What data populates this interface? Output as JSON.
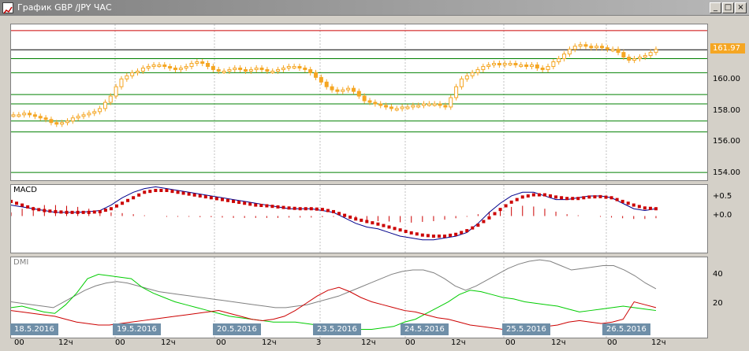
{
  "window": {
    "title": "График GBP /JPY ЧАС",
    "minimize_label": "_",
    "maximize_label": "□",
    "close_label": "×"
  },
  "price": {
    "current_label": "161.97",
    "current_value": 161.97,
    "ymin": 153.6,
    "ymax": 163.6,
    "ticks": [
      {
        "value": 160,
        "label": "160.00"
      },
      {
        "value": 158,
        "label": "158.00"
      },
      {
        "value": 156,
        "label": "156.00"
      },
      {
        "value": 154,
        "label": "154.00"
      }
    ],
    "red_levels": [
      163.2
    ],
    "black_levels": [
      161.97
    ],
    "green_levels": [
      161.4,
      160.5,
      159.1,
      158.5,
      157.4,
      156.7,
      154.1
    ],
    "closes": [
      157.8,
      157.8,
      157.9,
      157.8,
      157.7,
      157.6,
      157.5,
      157.3,
      157.2,
      157.3,
      157.4,
      157.6,
      157.7,
      157.8,
      157.9,
      158.0,
      158.2,
      158.6,
      159.0,
      159.6,
      160.1,
      160.3,
      160.5,
      160.6,
      160.8,
      160.9,
      161.0,
      161.0,
      160.9,
      160.8,
      160.7,
      160.8,
      160.9,
      161.1,
      161.2,
      161.1,
      160.9,
      160.7,
      160.6,
      160.6,
      160.7,
      160.8,
      160.7,
      160.6,
      160.7,
      160.8,
      160.7,
      160.6,
      160.6,
      160.7,
      160.8,
      160.9,
      160.9,
      160.8,
      160.7,
      160.5,
      160.2,
      159.9,
      159.6,
      159.4,
      159.3,
      159.4,
      159.5,
      159.3,
      159.0,
      158.7,
      158.6,
      158.5,
      158.4,
      158.3,
      158.2,
      158.2,
      158.3,
      158.3,
      158.4,
      158.4,
      158.5,
      158.5,
      158.5,
      158.4,
      158.3,
      158.9,
      159.6,
      160.1,
      160.3,
      160.5,
      160.7,
      160.9,
      161.0,
      161.1,
      161.0,
      161.1,
      161.1,
      161.0,
      161.0,
      160.9,
      161.0,
      160.8,
      160.7,
      160.9,
      161.2,
      161.4,
      161.7,
      162.0,
      162.2,
      162.3,
      162.2,
      162.1,
      162.2,
      162.1,
      162.0,
      162.0,
      161.8,
      161.5,
      161.3,
      161.4,
      161.5,
      161.6,
      161.8,
      162.0
    ]
  },
  "macd": {
    "title": "MACD",
    "ymin": -1.0,
    "ymax": 0.85,
    "ticks": [
      {
        "value": 0.5,
        "label": "+0.5"
      },
      {
        "value": 0.0,
        "label": "+0.0"
      }
    ],
    "macd_line": [
      0.3,
      0.25,
      0.2,
      0.15,
      0.1,
      0.1,
      0.1,
      0.12,
      0.15,
      0.3,
      0.5,
      0.65,
      0.75,
      0.8,
      0.75,
      0.7,
      0.65,
      0.6,
      0.55,
      0.5,
      0.45,
      0.4,
      0.35,
      0.3,
      0.25,
      0.2,
      0.2,
      0.2,
      0.15,
      0.1,
      -0.05,
      -0.2,
      -0.3,
      -0.35,
      -0.45,
      -0.55,
      -0.6,
      -0.65,
      -0.65,
      -0.6,
      -0.55,
      -0.45,
      -0.2,
      0.1,
      0.35,
      0.55,
      0.65,
      0.65,
      0.55,
      0.45,
      0.45,
      0.5,
      0.55,
      0.55,
      0.5,
      0.35,
      0.2,
      0.15,
      0.2
    ],
    "signal_line": [
      0.4,
      0.3,
      0.2,
      0.15,
      0.12,
      0.1,
      0.1,
      0.1,
      0.12,
      0.2,
      0.35,
      0.5,
      0.65,
      0.7,
      0.7,
      0.65,
      0.6,
      0.55,
      0.5,
      0.45,
      0.4,
      0.35,
      0.3,
      0.28,
      0.25,
      0.22,
      0.2,
      0.2,
      0.18,
      0.12,
      0.02,
      -0.08,
      -0.15,
      -0.22,
      -0.3,
      -0.38,
      -0.46,
      -0.52,
      -0.55,
      -0.55,
      -0.5,
      -0.4,
      -0.25,
      -0.05,
      0.18,
      0.38,
      0.52,
      0.58,
      0.58,
      0.52,
      0.48,
      0.48,
      0.52,
      0.53,
      0.5,
      0.4,
      0.3,
      0.22,
      0.2
    ],
    "histogram": [
      0.1,
      0.2,
      0.25,
      0.3,
      0.3,
      0.28,
      0.25,
      0.2,
      0.15,
      0.1,
      0.08,
      0.05,
      0.02,
      0.0,
      -0.02,
      -0.02,
      -0.02,
      -0.03,
      -0.03,
      -0.04,
      -0.05,
      -0.05,
      -0.05,
      -0.05,
      -0.05,
      -0.04,
      -0.04,
      -0.04,
      -0.03,
      -0.02,
      -0.04,
      -0.08,
      -0.12,
      -0.14,
      -0.15,
      -0.17,
      -0.18,
      -0.16,
      -0.14,
      -0.1,
      -0.06,
      -0.02,
      0.05,
      0.12,
      0.2,
      0.25,
      0.28,
      0.26,
      0.2,
      0.12,
      0.05,
      0.02,
      0.0,
      -0.02,
      -0.04,
      -0.06,
      -0.08,
      -0.08,
      -0.06
    ]
  },
  "dmi": {
    "title": "DMI",
    "ymin": 0,
    "ymax": 50,
    "ticks": [
      {
        "value": 40,
        "label": "40"
      },
      {
        "value": 20,
        "label": "20"
      }
    ],
    "adx": [
      22,
      21,
      20,
      19,
      18,
      22,
      26,
      30,
      33,
      35,
      36,
      35,
      33,
      31,
      29,
      28,
      27,
      26,
      25,
      24,
      23,
      22,
      21,
      20,
      19,
      18,
      18,
      19,
      20,
      22,
      24,
      26,
      29,
      32,
      35,
      38,
      41,
      43,
      44,
      44,
      42,
      38,
      33,
      30,
      33,
      37,
      41,
      45,
      48,
      50,
      51,
      50,
      47,
      44,
      45,
      46,
      47,
      47,
      44,
      40,
      35,
      31
    ],
    "plus_di": [
      18,
      19,
      17,
      15,
      14,
      20,
      28,
      38,
      41,
      40,
      39,
      38,
      32,
      28,
      25,
      22,
      20,
      18,
      16,
      14,
      12,
      11,
      10,
      9,
      8,
      8,
      8,
      7,
      6,
      5,
      4,
      4,
      3,
      3,
      4,
      5,
      8,
      10,
      14,
      18,
      22,
      27,
      30,
      29,
      27,
      25,
      24,
      22,
      21,
      20,
      19,
      17,
      15,
      16,
      17,
      18,
      19,
      18,
      17,
      16
    ],
    "minus_di": [
      16,
      15,
      14,
      13,
      12,
      10,
      8,
      7,
      6,
      6,
      7,
      8,
      9,
      10,
      11,
      12,
      13,
      14,
      15,
      16,
      14,
      12,
      10,
      9,
      10,
      12,
      16,
      21,
      26,
      30,
      32,
      29,
      25,
      22,
      20,
      18,
      16,
      15,
      13,
      11,
      10,
      8,
      6,
      5,
      4,
      3,
      3,
      3,
      4,
      5,
      6,
      8,
      9,
      8,
      7,
      8,
      10,
      22,
      20,
      18
    ]
  },
  "time_axis": {
    "dates": [
      "18.5.2016",
      "19.5.2016",
      "20.5.2016",
      "23.5.2016",
      "24.5.2016",
      "25.5.2016",
      "26.5.2016"
    ],
    "hours": [
      "00",
      "12ч",
      "00",
      "12ч",
      "00",
      "12ч",
      "3",
      "12ч",
      "00",
      "12ч",
      "00",
      "12ч",
      "00",
      "12ч"
    ]
  },
  "colors": {
    "candle": "#f5a623",
    "macd_line": "#00008b",
    "signal": "#cc0000",
    "adx": "#808080",
    "plus_di": "#00cc00",
    "minus_di": "#cc0000",
    "grid_vertical": "#c0c0c0",
    "green_level": "#008000",
    "red_level": "#cc0000"
  }
}
